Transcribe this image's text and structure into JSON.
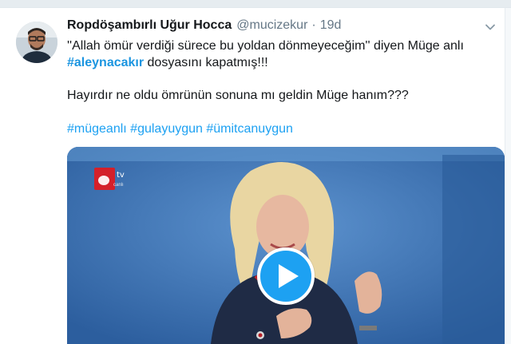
{
  "tweet": {
    "author_name": "Ropdöşambırlı Uğur Hocca",
    "handle": "@mucizekur",
    "separator": "·",
    "time": "19d",
    "line1": "''Allah ömür verdiği sürece bu yoldan dönmeyeceğim'' diyen Müge anlı",
    "line2_tag": "#aleynacakır",
    "line2_rest": " dosyasını kapatmış!!!",
    "line3": "Hayırdır ne oldu ömrünün sonuna mı geldin Müge hanım???",
    "hashtags": [
      "#mügeanlı",
      "#gulayuygun",
      "#ümitcanuygun"
    ]
  },
  "media": {
    "channel_logo_text": "a",
    "channel_tv": "tv",
    "channel_sub": "canlı",
    "play_icon": "play-icon"
  },
  "colors": {
    "link": "#1da1f2",
    "text": "#14171a",
    "muted": "#657786",
    "play": "#1da1f2",
    "studio_bg": "#3a6fb0"
  }
}
